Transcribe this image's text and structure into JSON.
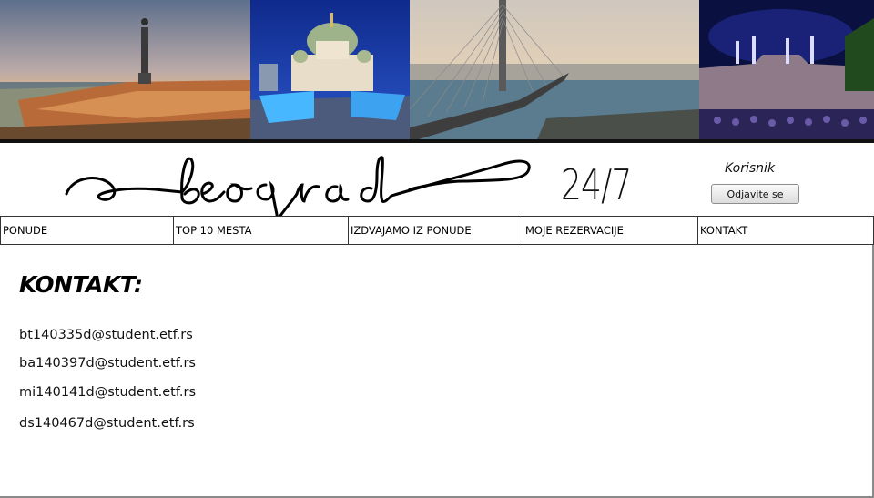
{
  "header": {
    "logo_text": "beograd",
    "tagline": "24/7",
    "user_label": "Korisnik",
    "logout_label": "Odjavite se"
  },
  "nav": [
    {
      "label": "PONUDE"
    },
    {
      "label": "TOP 10 MESTA"
    },
    {
      "label": "IZDVAJAMO IZ PONUDE"
    },
    {
      "label": "MOJE REZERVACIJE"
    },
    {
      "label": "KONTAKT"
    }
  ],
  "main": {
    "title": "KONTAKT:",
    "emails": [
      "bt140335d@student.etf.rs",
      "ba140397d@student.etf.rs",
      "mi140141d@student.etf.rs",
      "ds140467d@student.etf.rs"
    ]
  }
}
